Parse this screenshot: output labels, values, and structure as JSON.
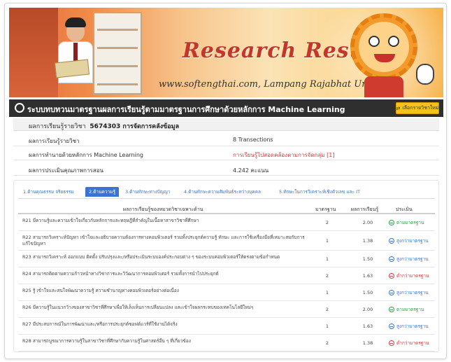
{
  "banner": {
    "title_art": "Research Result",
    "subtitle": "www.softengthai.com, Lampang Rajabhat University."
  },
  "header": {
    "title": "ระบบทบทวนมาตรฐานผลการเรียนรู้ตามมาตรฐานการศึกษาด้วยหลักการ Machine Learning",
    "change_button": "เลือกรายวิชาใหม่"
  },
  "course": {
    "label": "ผลการเรียนรู้รายวิชา",
    "code_name": "5674303 การจัดการคลังข้อมูล"
  },
  "info_rows": [
    {
      "label": "ผลการเรียนรู้รายวิชา",
      "value": "8 Transections",
      "red": false
    },
    {
      "label": "ผลการทำนายด้วยหลักการ Machine Learning",
      "value": "การเรียนรู้ไปสอดคล้องตามการจัดกลุ่ม [1]",
      "red": true
    },
    {
      "label": "ผลการประเมินคุณภาพการสอน",
      "value": "4.242 คะแนน",
      "red": false
    }
  ],
  "tabs": [
    "1.ด้านคุณธรรม จริยธรรม",
    "2.ด้านความรู้",
    "3.ด้านทักษะทางปัญญา",
    "4.ด้านทักษะความสัมพันธ์ระหว่างบุคคล",
    "5.ทักษะในการวิเคราะห์เชิงตัวเลข และ IT"
  ],
  "active_tab": 1,
  "table": {
    "headers": {
      "desc": "ผลการเรียนรู้ของหมวดวิชาเฉพาะด้าน",
      "std": "มาตรฐาน",
      "score": "ผลการเรียนรู้",
      "eval": "ประเมิน"
    },
    "rows": [
      {
        "desc": "R21 มีความรู้และความเข้าใจเกี่ยวกับหลักการและทฤษฎีที่สำคัญในเนื้อหาสาขาวิชาที่ศึกษา",
        "std": "2",
        "score": "2.00",
        "eval": "ตามมาตรฐาน",
        "status": "green"
      },
      {
        "desc": "R22 สามารถวิเคราะห์ปัญหา เข้าใจและอธิบายความต้องการทางคอมพิวเตอร์ รวมทั้งประยุกต์ความรู้ ทักษะ และการใช้เครื่องมือที่เหมาะสมกับการแก้ไขปัญหา",
        "std": "1",
        "score": "1.38",
        "eval": "สูงกว่ามาตรฐาน",
        "status": "blue"
      },
      {
        "desc": "R23 สามารถวิเคราะห์ ออกแบบ ติดตั้ง ปรับปรุงและ/หรือประเมินระบบองค์ประกอบต่าง ๆ ของระบบคอมพิวเตอร์ให้ตรงตามข้อกำหนด",
        "std": "1",
        "score": "1.50",
        "eval": "สูงกว่ามาตรฐาน",
        "status": "blue"
      },
      {
        "desc": "R24 สามารถติดตามความก้าวหน้าทางวิชาการและวิวัฒนาการคอมพิวเตอร์ รวมทั้งการนำไปประยุกต์",
        "std": "2",
        "score": "1.63",
        "eval": "ต่ำกว่ามาตรฐาน",
        "status": "red"
      },
      {
        "desc": "R25 รู้ เข้าใจและสนใจพัฒนาความรู้ ความชำนาญทางคอมพิวเตอร์อย่างต่อเนื่อง",
        "std": "1",
        "score": "1.50",
        "eval": "สูงกว่ามาตรฐาน",
        "status": "blue"
      },
      {
        "desc": "R26 มีความรู้ในแนวกว้างของสาขาวิชาที่ศึกษาเพื่อให้เล็งเห็นการเปลี่ยนแปลง และเข้าใจผลกระทบของเทคโนโลยีใหม่ๆ",
        "std": "2",
        "score": "2.00",
        "eval": "ตามมาตรฐาน",
        "status": "green"
      },
      {
        "desc": "R27 มีประสบการณ์ในการพัฒนาและ/หรือการประยุกต์ซอฟต์แวร์ที่ใช้งานได้จริง",
        "std": "1",
        "score": "1.63",
        "eval": "สูงกว่ามาตรฐาน",
        "status": "blue"
      },
      {
        "desc": "R28 สามารถบูรณาการความรู้ในสาขาวิชาที่ศึกษากับความรู้ในศาสตร์อื่น ๆ ที่เกี่ยวข้อง",
        "std": "2",
        "score": "1.38",
        "eval": "ต่ำกว่ามาตรฐาน",
        "status": "red"
      }
    ]
  },
  "colors": {
    "header_bg": "#2f2f2f",
    "accent_button": "#f4c21b",
    "tab_active": "#3b74d0",
    "status_green": "#2f9e44",
    "status_blue": "#3c76cf",
    "status_red": "#d43b3b"
  }
}
